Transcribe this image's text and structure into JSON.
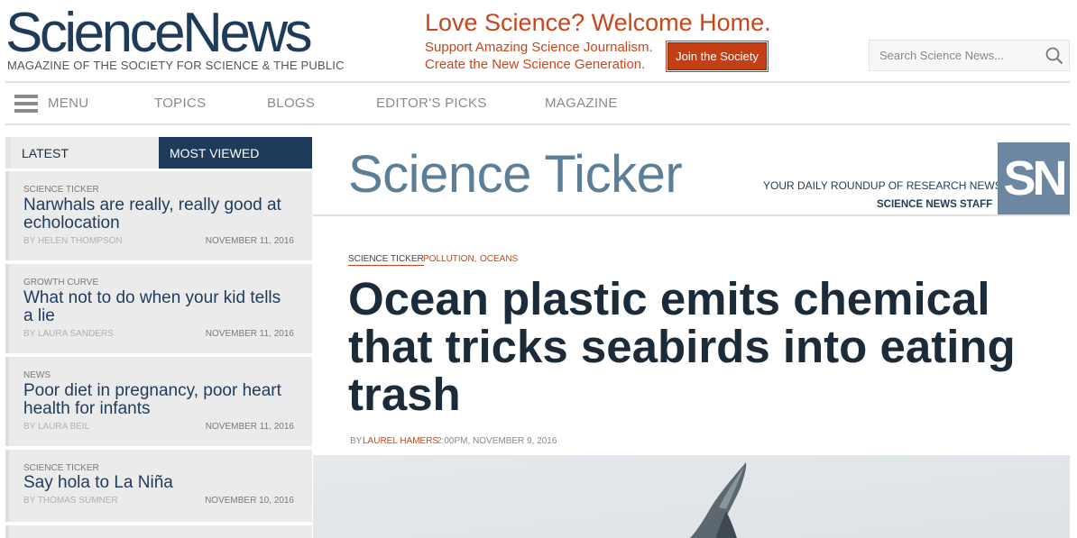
{
  "brand": {
    "title": "ScienceNews",
    "subtitle": "MAGAZINE OF THE SOCIETY FOR SCIENCE & THE PUBLIC"
  },
  "promo": {
    "title": "Love Science? Welcome Home.",
    "line1": "Support Amazing Science Journalism.",
    "line2": "Create the New Science Generation.",
    "button": "Join the Society"
  },
  "search": {
    "placeholder": "Search Science News..."
  },
  "nav": {
    "menu": "MENU",
    "items": [
      "TOPICS",
      "BLOGS",
      "EDITOR'S PICKS",
      "MAGAZINE"
    ]
  },
  "sidebar": {
    "tabs": [
      "LATEST",
      "MOST VIEWED"
    ],
    "items": [
      {
        "kicker": "SCIENCE TICKER",
        "headline": "Narwhals are really, really good at echolocation",
        "byline": "BY HELEN THOMPSON",
        "date": "NOVEMBER 11, 2016"
      },
      {
        "kicker": "GROWTH CURVE",
        "headline": "What not to do when your kid tells a lie",
        "byline": "BY LAURA SANDERS",
        "date": "NOVEMBER 11, 2016"
      },
      {
        "kicker": "NEWS",
        "headline": "Poor diet in pregnancy, poor heart health for infants",
        "byline": "BY LAURA BEIL",
        "date": "NOVEMBER 11, 2016"
      },
      {
        "kicker": "SCIENCE TICKER",
        "headline": "Say hola to La Niña",
        "byline": "BY THOMAS SUMNER",
        "date": "NOVEMBER 10, 2016"
      }
    ]
  },
  "section": {
    "title": "Science Ticker",
    "tagline": "YOUR DAILY ROUNDUP OF RESEARCH NEWS",
    "staff": "SCIENCE NEWS STAFF",
    "badge": "SN"
  },
  "article": {
    "tags": [
      "SCIENCE TICKER",
      "POLLUTION,",
      "OCEANS"
    ],
    "title": "Ocean plastic emits chemical that tricks seabirds into eating trash",
    "by": "BY",
    "author": "LAUREL HAMERS",
    "time": "2:00PM, NOVEMBER 9, 2016"
  },
  "colors": {
    "brand_blue": "#1f3b5c",
    "accent_orange": "#c8461b",
    "badge": "#6d87a1"
  }
}
